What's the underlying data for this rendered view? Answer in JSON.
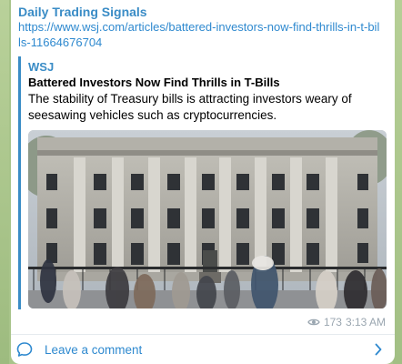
{
  "message": {
    "channel_name": "Daily Trading Signals",
    "link": "https://www.wsj.com/articles/battered-investors-now-find-thrills-in-t-bills-11664676704",
    "preview": {
      "site_name": "WSJ",
      "title": "Battered Investors Now Find Thrills in T-Bills",
      "description": "The stability of Treasury bills is attracting investors weary of seesawing vehicles such as cryptocurrencies."
    },
    "views": "173",
    "time": "3:13 AM"
  },
  "comments": {
    "label": "Leave a comment"
  },
  "colors": {
    "accent": "#3a8cc6",
    "link": "#2e89cf",
    "meta": "#9aa6b0",
    "background": "#a8c48a"
  }
}
